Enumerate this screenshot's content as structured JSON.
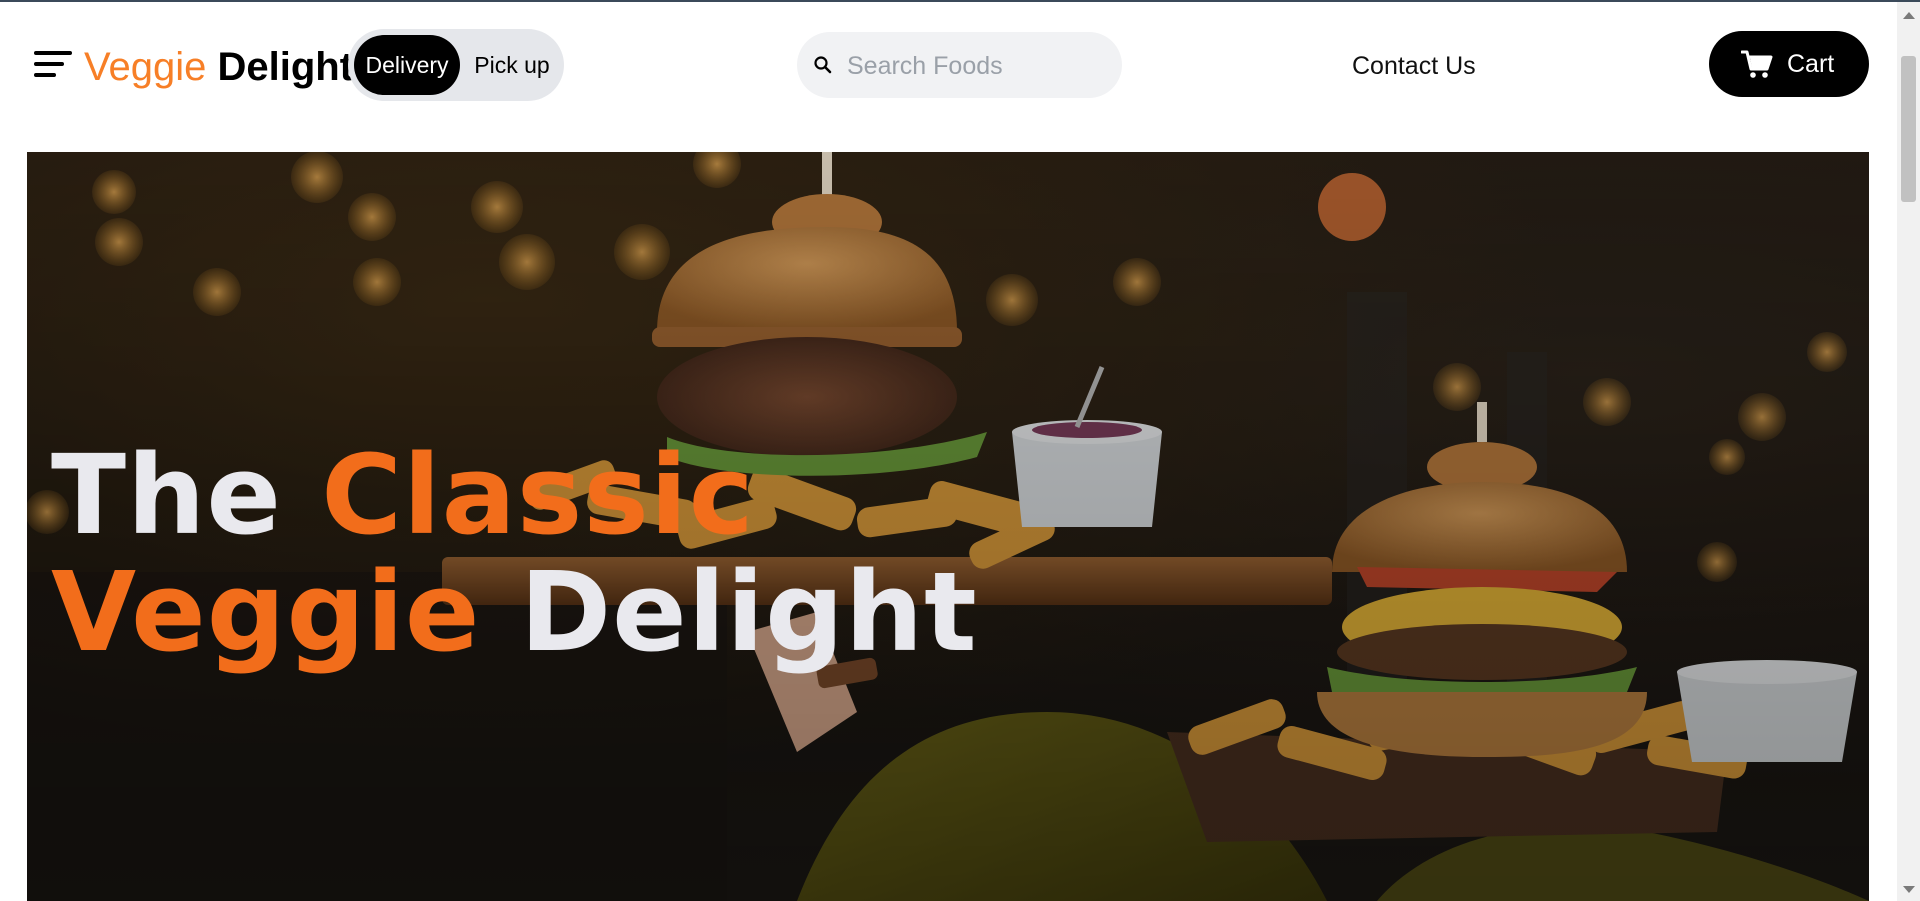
{
  "brand": {
    "part1": "Veggie",
    "part2": "Delight"
  },
  "order_mode": {
    "delivery_label": "Delivery",
    "pickup_label": "Pick up",
    "selected": "Delivery"
  },
  "search": {
    "placeholder": "Search Foods",
    "value": "",
    "icon": "search-icon"
  },
  "nav": {
    "contact_label": "Contact Us"
  },
  "cart": {
    "label": "Cart",
    "icon": "cart-icon"
  },
  "hero": {
    "line1_word1": "The",
    "line1_word2": "Classic",
    "line2_word1": "Veggie",
    "line2_word2": "Delight",
    "image": "burgers-and-fries-on-wooden-boards-photo"
  },
  "colors": {
    "brand_orange": "#f77f27",
    "hero_accent": "#f26d1b",
    "button_black": "#000000",
    "search_bg": "#f1f2f4",
    "toggle_bg": "#e5e7eb"
  }
}
